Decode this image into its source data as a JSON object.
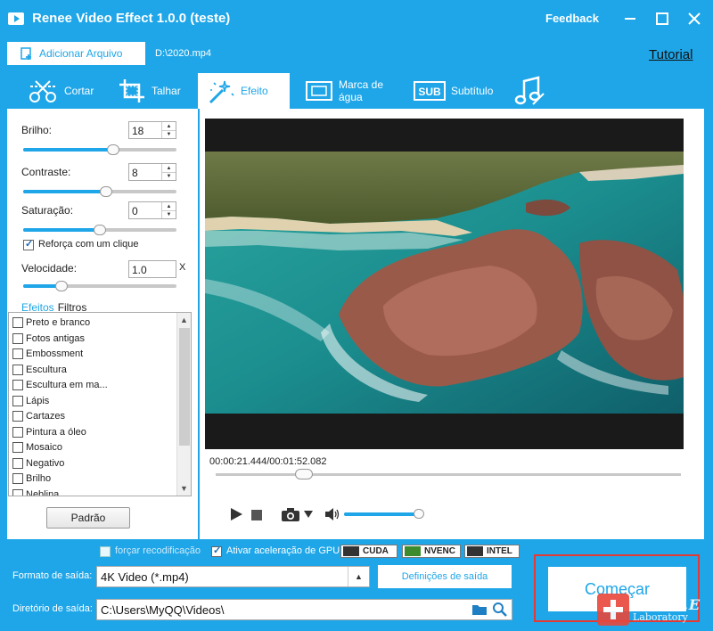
{
  "window": {
    "title": "Renee Video Effect 1.0.0 (teste)",
    "feedback": "Feedback",
    "brand_color": "#1ea6e8"
  },
  "toolbar": {
    "add_file_label": "Adicionar Arquivo",
    "file_path": "D:\\2020.mp4",
    "tutorial": "Tutorial"
  },
  "tabs": [
    {
      "label": "Cortar",
      "icon": "cut-icon",
      "active": false
    },
    {
      "label": "Talhar",
      "icon": "crop-icon",
      "active": false
    },
    {
      "label": "Efeito",
      "icon": "effect-wand-icon",
      "active": true
    },
    {
      "label": "Marca de água",
      "icon": "watermark-icon",
      "active": false
    },
    {
      "label": "Subtítulo",
      "icon": "subtitle-icon",
      "active": false
    },
    {
      "label": "",
      "icon": "music-icon",
      "active": false
    }
  ],
  "adjust": {
    "brightness": {
      "label": "Brilho:",
      "value": "18",
      "level": 0.59
    },
    "contrast": {
      "label": "Contraste:",
      "value": "8",
      "level": 0.54
    },
    "saturation": {
      "label": "Saturação:",
      "value": "0",
      "level": 0.5
    },
    "one_click": {
      "label": "Reforça com um clique",
      "checked": true
    },
    "speed": {
      "label": "Velocidade:",
      "value": "1.0",
      "unit": "X",
      "level": 0.25
    }
  },
  "effect_tabs": {
    "effects": "Efeitos",
    "filters": "Filtros"
  },
  "effects": [
    "Preto e branco",
    "Fotos antigas",
    "Embossment",
    "Escultura",
    "Escultura em ma...",
    "Lápis",
    "Cartazes",
    "Pintura a óleo",
    "Mosaico",
    "Negativo",
    "Brilho",
    "Neblina"
  ],
  "default_button": "Padrão",
  "player": {
    "current_time": "00:00:21.444",
    "separator": "/",
    "total_time": "00:01:52.082",
    "progress": 0.19,
    "volume": 0.98
  },
  "encoding": {
    "force_reencode": {
      "label": "forçar recodificação",
      "checked": false
    },
    "gpu": {
      "label": "Ativar aceleração de GPU",
      "checked": true
    },
    "badges": [
      "CUDA",
      "NVENC",
      "INTEL"
    ]
  },
  "output": {
    "format_label": "Formato de saída:",
    "format_value": "4K Video (*.mp4)",
    "settings_button": "Definições de saída",
    "dir_label": "Diretório de saída:",
    "dir_value": "C:\\Users\\MyQQ\\Videos\\"
  },
  "start_button": "Começar",
  "watermark": {
    "line1": "RENE.E",
    "line2": "Laboratory"
  }
}
